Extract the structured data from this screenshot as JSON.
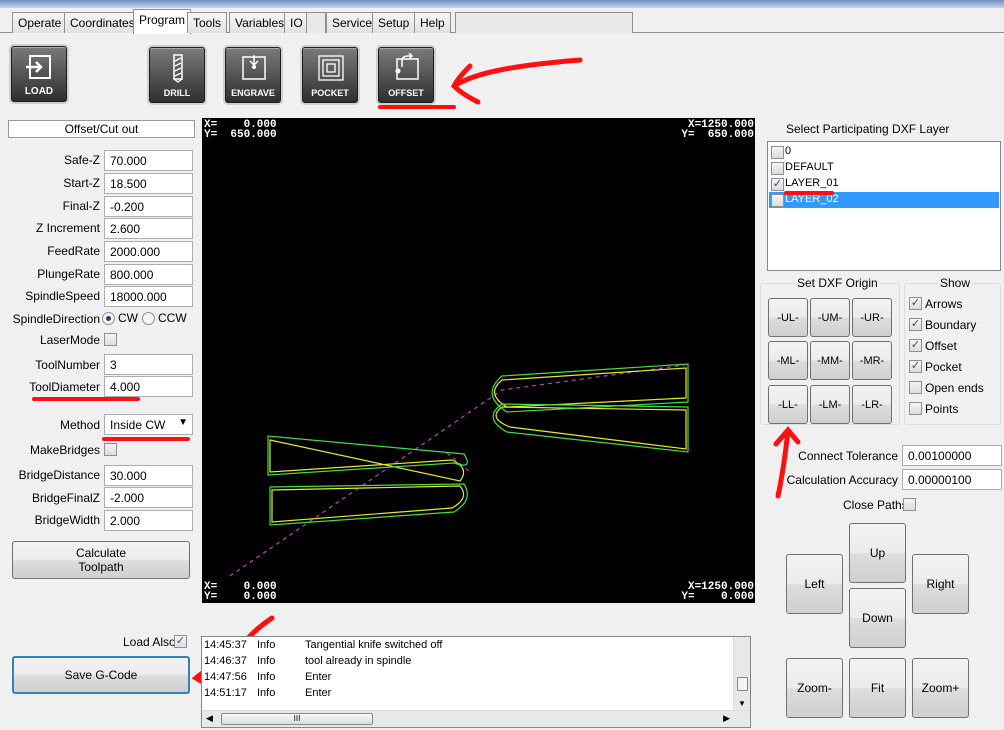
{
  "tabs": [
    "Operate",
    "Coordinates",
    "Program",
    "Tools",
    "Variables",
    "IO",
    "Service",
    "Setup",
    "Help"
  ],
  "active_tab": "Program",
  "toolbar": {
    "load": "LOAD",
    "drill": "DRILL",
    "engrave": "ENGRAVE",
    "pocket": "POCKET",
    "offset": "OFFSET"
  },
  "panel_title": "Offset/Cut out",
  "params": {
    "safe_z": {
      "label": "Safe-Z",
      "value": "70.000"
    },
    "start_z": {
      "label": "Start-Z",
      "value": "18.500"
    },
    "final_z": {
      "label": "Final-Z",
      "value": "-0.200"
    },
    "z_increment": {
      "label": "Z Increment",
      "value": "2.600"
    },
    "feedrate": {
      "label": "FeedRate",
      "value": "2000.000"
    },
    "plungerate": {
      "label": "PlungeRate",
      "value": "800.000"
    },
    "spindlespeed": {
      "label": "SpindleSpeed",
      "value": "18000.000"
    },
    "spindledir": {
      "label": "SpindleDirection",
      "cw": "CW",
      "ccw": "CCW"
    },
    "lasermode": {
      "label": "LaserMode"
    },
    "toolnumber": {
      "label": "ToolNumber",
      "value": "3"
    },
    "tooldiameter": {
      "label": "ToolDiameter",
      "value": "4.000"
    },
    "method": {
      "label": "Method",
      "value": "Inside CW"
    },
    "makebridges": {
      "label": "MakeBridges"
    },
    "bridgedistance": {
      "label": "BridgeDistance",
      "value": "30.000"
    },
    "bridgefinalz": {
      "label": "BridgeFinalZ",
      "value": "-2.000"
    },
    "bridgewidth": {
      "label": "BridgeWidth",
      "value": "2.000"
    }
  },
  "calc_button": {
    "line1": "Calculate",
    "line2": "Toolpath"
  },
  "load_also": "Load Also",
  "save_button": "Save G-Code",
  "canvas": {
    "tl": "X=    0.000\nY=  650.000",
    "tr": "X=1250.000\nY=  650.000",
    "bl": "X=    0.000\nY=    0.000",
    "br": "X=1250.000\nY=    0.000"
  },
  "log": [
    {
      "time": "14:45:37",
      "level": "Info",
      "msg": "Tangential knife switched off"
    },
    {
      "time": "14:46:37",
      "level": "Info",
      "msg": "tool already in spindle"
    },
    {
      "time": "14:47:56",
      "level": "Info",
      "msg": "Enter"
    },
    {
      "time": "14:51:17",
      "level": "Info",
      "msg": "Enter"
    }
  ],
  "layers": {
    "title": "Select Participating DXF Layer",
    "items": [
      {
        "name": "0",
        "checked": false
      },
      {
        "name": "DEFAULT",
        "checked": false
      },
      {
        "name": "LAYER_01",
        "checked": true
      },
      {
        "name": "LAYER_02",
        "checked": false
      }
    ]
  },
  "origin": {
    "title": "Set DXF Origin",
    "buttons": [
      "-UL-",
      "-UM-",
      "-UR-",
      "-ML-",
      "-MM-",
      "-MR-",
      "-LL-",
      "-LM-",
      "-LR-"
    ]
  },
  "show": {
    "title": "Show",
    "items": [
      {
        "label": "Arrows",
        "checked": true
      },
      {
        "label": "Boundary",
        "checked": true
      },
      {
        "label": "Offset",
        "checked": true
      },
      {
        "label": "Pocket",
        "checked": true
      },
      {
        "label": "Open ends",
        "checked": false
      },
      {
        "label": "Points",
        "checked": false
      }
    ]
  },
  "tolerance": {
    "label": "Connect Tolerance",
    "value": "0.00100000"
  },
  "accuracy": {
    "label": "Calculation Accuracy",
    "value": "0.00000100"
  },
  "close_paths": "Close Paths",
  "nav": {
    "up": "Up",
    "left": "Left",
    "right": "Right",
    "down": "Down",
    "zoom_minus": "Zoom-",
    "fit": "Fit",
    "zoom_plus": "Zoom+"
  },
  "log_scroll_thumb": "III",
  "colors": {
    "annotation": "#ff1010",
    "selection": "#3399ff",
    "contour": "#e8e832",
    "offset_path": "#44dd44",
    "rapid": "#c040c0"
  }
}
